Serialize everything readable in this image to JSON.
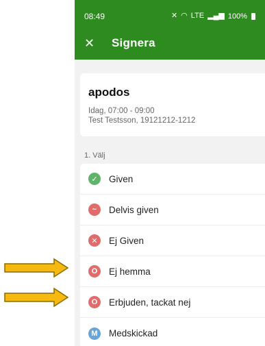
{
  "status_bar": {
    "time": "08:49",
    "network_label": "LTE",
    "battery": "100%"
  },
  "app_bar": {
    "title": "Signera"
  },
  "info_card": {
    "title": "apodos",
    "time_range": "Idag, 07:00 - 09:00",
    "patient": "Test Testsson, 19121212-1212"
  },
  "section": {
    "label": "1. Välj"
  },
  "options": [
    {
      "label": "Given",
      "icon": "check-icon",
      "color": "#5fb46a",
      "symbol": "✓"
    },
    {
      "label": "Delvis given",
      "icon": "tilde-icon",
      "color": "#e06c6c",
      "symbol": "~"
    },
    {
      "label": "Ej Given",
      "icon": "cross-icon",
      "color": "#e06c6c",
      "symbol": "✕"
    },
    {
      "label": "Ej hemma",
      "icon": "o-letter-icon",
      "color": "#e06c6c",
      "symbol": "O"
    },
    {
      "label": "Erbjuden, tackat nej",
      "icon": "o-letter-icon",
      "color": "#e06c6c",
      "symbol": "O"
    },
    {
      "label": "Medskickad",
      "icon": "m-letter-icon",
      "color": "#6aa5d8",
      "symbol": "M"
    }
  ],
  "colors": {
    "brand_green": "#2e8b1f",
    "arrow_fill": "#f5b90f",
    "arrow_stroke": "#8a6a00"
  }
}
